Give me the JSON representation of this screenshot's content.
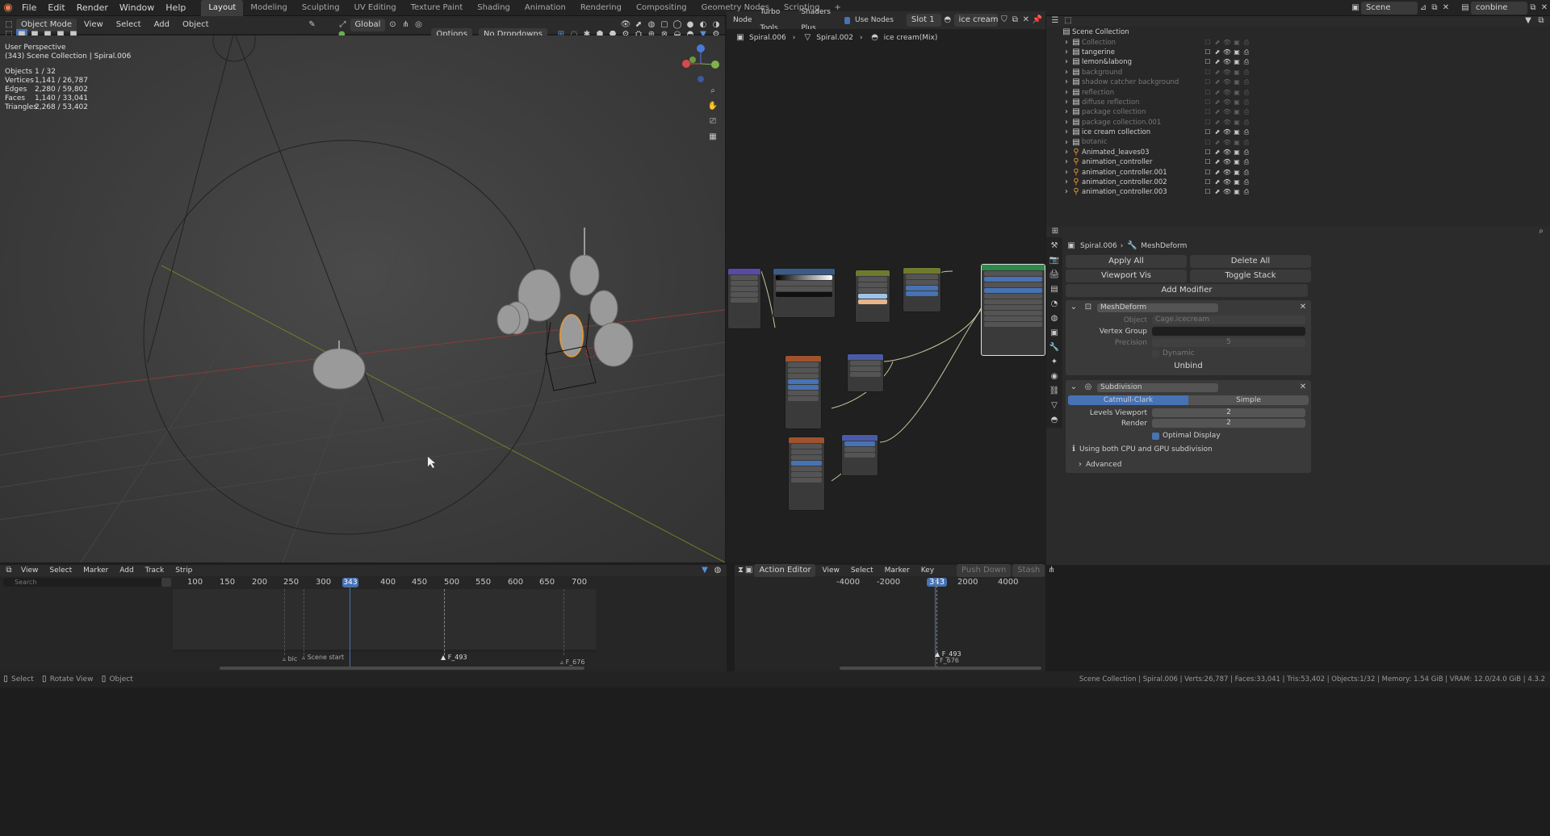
{
  "topbar": {
    "menus": [
      "File",
      "Edit",
      "Render",
      "Window",
      "Help"
    ],
    "workspaces": [
      "Layout",
      "Modeling",
      "Sculpting",
      "UV Editing",
      "Texture Paint",
      "Shading",
      "Animation",
      "Rendering",
      "Compositing",
      "Geometry Nodes",
      "Scripting"
    ],
    "active_workspace": "Layout",
    "scene": "Scene",
    "view_layer": "conbine"
  },
  "viewport": {
    "header": {
      "mode": "Object Mode",
      "menus": [
        "View",
        "Select",
        "Add",
        "Object"
      ],
      "orientation": "Global",
      "options": "Options",
      "dropdown": "No Dropdowns"
    },
    "overlay_title": "User Perspective",
    "overlay_collection": "(343) Scene Collection | Spiral.006",
    "stats": [
      {
        "label": "Objects",
        "value": "1 / 32"
      },
      {
        "label": "Vertices",
        "value": "1,141 / 26,787"
      },
      {
        "label": "Edges",
        "value": "2,280 / 59,802"
      },
      {
        "label": "Faces",
        "value": "1,140 / 33,041"
      },
      {
        "label": "Triangles",
        "value": "2,268 / 53,402"
      }
    ]
  },
  "node_editor": {
    "menus": [
      "Node",
      "Turbo Tools",
      "Shaders Plus"
    ],
    "use_nodes": "Use Nodes",
    "slot": "Slot 1",
    "material": "ice cream(Mix)",
    "breadcrumb": [
      "Spiral.006",
      "Spiral.002",
      "ice cream(Mix)"
    ]
  },
  "outliner": {
    "root": "Scene Collection",
    "items": [
      {
        "label": "Collection",
        "dim": true
      },
      {
        "label": "tangerine",
        "dim": false
      },
      {
        "label": "lemon&labong",
        "dim": false
      },
      {
        "label": "background",
        "dim": true
      },
      {
        "label": "shadow catcher background",
        "dim": true
      },
      {
        "label": "reflection",
        "dim": true
      },
      {
        "label": "diffuse reflection",
        "dim": true
      },
      {
        "label": "package collection",
        "dim": true
      },
      {
        "label": "package collection.001",
        "dim": true
      },
      {
        "label": "ice cream collection",
        "dim": false
      },
      {
        "label": "botanic",
        "dim": true
      },
      {
        "label": "Animated_leaves03",
        "dim": false
      },
      {
        "label": "animation_controller",
        "dim": false
      },
      {
        "label": "animation_controller.001",
        "dim": false
      },
      {
        "label": "animation_controller.002",
        "dim": false
      },
      {
        "label": "animation_controller.003",
        "dim": false
      }
    ]
  },
  "properties": {
    "breadcrumb": [
      "Spiral.006",
      "MeshDeform"
    ],
    "apply_all": "Apply All",
    "delete_all": "Delete All",
    "viewport_vis": "Viewport Vis",
    "toggle_stack": "Toggle Stack",
    "add_modifier": "Add Modifier",
    "mesh_deform": {
      "name": "MeshDeform",
      "object_label": "Object",
      "object_value": "Cage.icecream",
      "vertex_group_label": "Vertex Group",
      "precision_label": "Precision",
      "precision_value": "5",
      "dynamic_label": "Dynamic",
      "unbind": "Unbind"
    },
    "subdivision": {
      "name": "Subdivision",
      "catmull": "Catmull-Clark",
      "simple": "Simple",
      "levels_viewport_label": "Levels Viewport",
      "levels_viewport_value": "2",
      "render_label": "Render",
      "render_value": "2",
      "optimal_display": "Optimal Display",
      "gpu_note": "Using both CPU and GPU subdivision",
      "advanced": "Advanced"
    }
  },
  "timeline": {
    "menus": [
      "View",
      "Select",
      "Marker",
      "Add",
      "Track",
      "Strip"
    ],
    "search_placeholder": "Search",
    "ticks": [
      "100",
      "150",
      "200",
      "250",
      "300",
      "343",
      "400",
      "450",
      "500",
      "550",
      "600",
      "650",
      "700"
    ],
    "current_frame": "343",
    "markers": [
      "bic",
      "Scene start",
      "F_493",
      "F_676"
    ]
  },
  "action_editor": {
    "mode": "Action Editor",
    "menus": [
      "View",
      "Select",
      "Marker",
      "Key"
    ],
    "push_down": "Push Down",
    "stash": "Stash",
    "ticks": [
      "-4000",
      "-2000",
      "343",
      "2000",
      "4000"
    ],
    "markers": [
      "F_493",
      "F_676"
    ]
  },
  "statusbar": {
    "left": [
      "Select",
      "Rotate View",
      "Object"
    ],
    "right": "Scene Collection | Spiral.006 | Verts:26,787 | Faces:33,041 | Tris:53,402 | Objects:1/32 | Memory: 1.54 GiB | VRAM: 12.0/24.0 GiB | 4.3.2"
  }
}
